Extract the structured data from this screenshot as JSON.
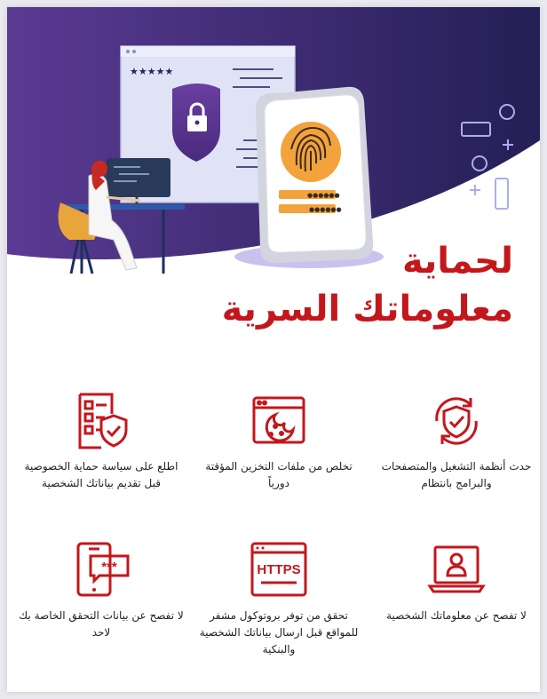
{
  "title": {
    "line1": "لحماية",
    "line2": "معلوماتك السرية"
  },
  "colors": {
    "accent": "#c3171c",
    "hero_dark": "#2a2360",
    "hero_purple": "#5b3a93"
  },
  "hero": {
    "password_stars": "★★★★★",
    "lock_icon": "padlock-icon",
    "fingerprint_icon": "fingerprint-icon"
  },
  "tips": [
    {
      "icon": "shield-refresh-icon",
      "text": "حدث أنظمة التشغيل والمتصفحات والبرامج بانتظام"
    },
    {
      "icon": "browser-cookie-icon",
      "text": "تخلص من ملفات  التخزين المؤقتة دورياً"
    },
    {
      "icon": "checklist-shield-icon",
      "text": "اطلع على سياسة حماية الخصوصية قبل تقديم بياناتك الشخصية"
    },
    {
      "icon": "laptop-user-icon",
      "text": "لا تفصح عن معلوماتك الشخصية"
    },
    {
      "icon": "https-icon",
      "text": "تحقق من توفر بروتوكول مشفر للمواقع قبل ارسال بياناتك الشخصية والبنكية"
    },
    {
      "icon": "phone-password-icon",
      "text": "لا تفصح عن بيانات التحقق الخاصة بك لاحد"
    }
  ],
  "https_label": "HTTPS",
  "password_mask": "***"
}
